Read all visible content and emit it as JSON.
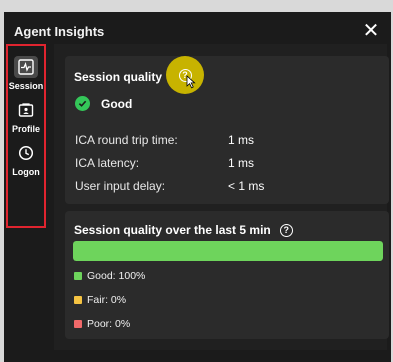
{
  "window": {
    "title": "Agent Insights",
    "close_label": "✕"
  },
  "sidebar": {
    "items": [
      {
        "label": "Session",
        "icon": "pulse-icon",
        "active": true
      },
      {
        "label": "Profile",
        "icon": "profile-card-icon",
        "active": false
      },
      {
        "label": "Logon",
        "icon": "clock-icon",
        "active": false
      }
    ]
  },
  "session_quality": {
    "title": "Session quality",
    "status": "Good",
    "metrics": [
      {
        "label": "ICA round trip time:",
        "value": "1 ms"
      },
      {
        "label": "ICA latency:",
        "value": "1 ms"
      },
      {
        "label": "User input delay:",
        "value": "< 1 ms"
      }
    ]
  },
  "history": {
    "title": "Session quality over the last 5 min",
    "good_fraction": 1.0,
    "legend": [
      {
        "label": "Good: 100%",
        "color": "#6ed45c"
      },
      {
        "label": "Fair: 0%",
        "color": "#f5c342"
      },
      {
        "label": "Poor: 0%",
        "color": "#f0696a"
      }
    ]
  },
  "help_glyph": "?"
}
